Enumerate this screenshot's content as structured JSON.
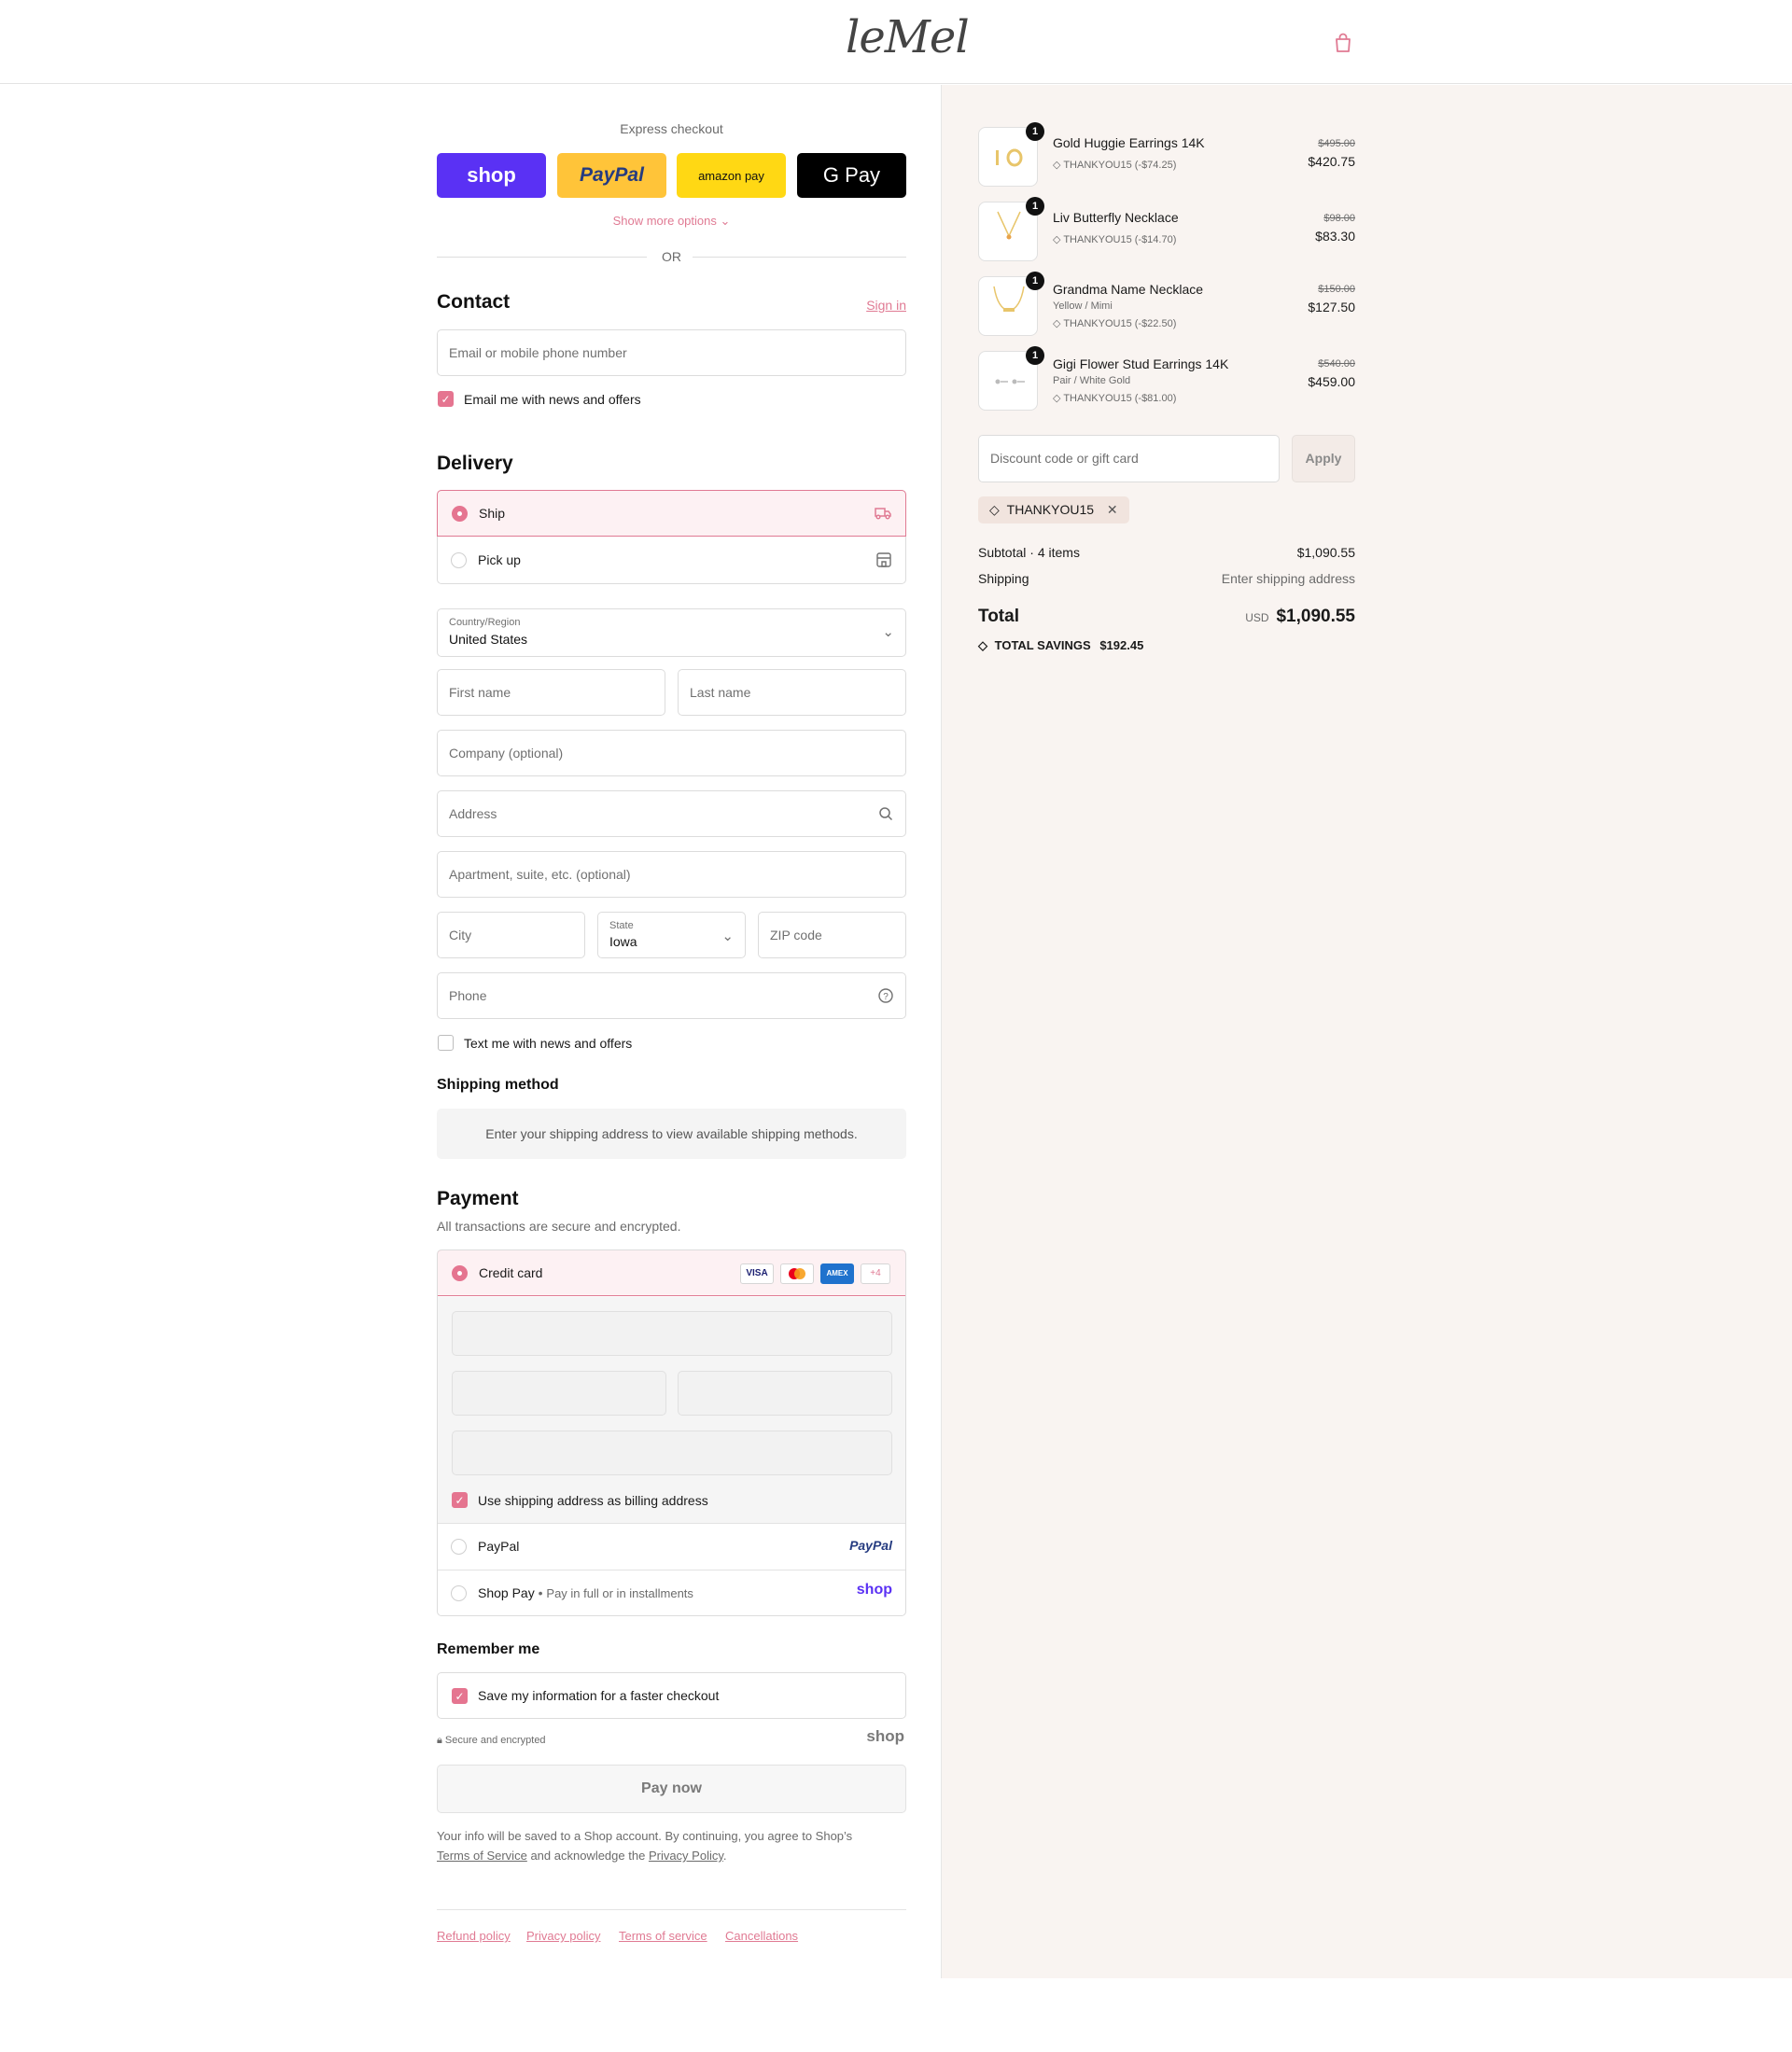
{
  "header": {
    "logo": "leMel",
    "cart_icon": "shopping-bag-icon"
  },
  "express": {
    "title": "Express checkout",
    "buttons": {
      "shop": "shop",
      "paypal": "PayPal",
      "amazon": "amazon pay",
      "gpay": "G Pay"
    },
    "more_options": "Show more options",
    "or": "OR"
  },
  "contact": {
    "title": "Contact",
    "sign_in": "Sign in",
    "email_placeholder": "Email or mobile phone number",
    "email_news_label": "Email me with news and offers",
    "email_news_checked": true
  },
  "delivery": {
    "title": "Delivery",
    "options": [
      {
        "label": "Ship",
        "selected": true,
        "icon": "truck-icon"
      },
      {
        "label": "Pick up",
        "selected": false,
        "icon": "store-icon"
      }
    ],
    "country_label": "Country/Region",
    "country_value": "United States",
    "first_name": "First name",
    "last_name": "Last name",
    "company": "Company (optional)",
    "address": "Address",
    "apartment": "Apartment, suite, etc. (optional)",
    "city": "City",
    "state_label": "State",
    "state_value": "Iowa",
    "zip": "ZIP code",
    "phone": "Phone",
    "text_news_label": "Text me with news and offers",
    "text_news_checked": false
  },
  "shipping_method": {
    "title": "Shipping method",
    "info": "Enter your shipping address to view available shipping methods."
  },
  "payment": {
    "title": "Payment",
    "subtitle": "All transactions are secure and encrypted.",
    "credit_card_label": "Credit card",
    "card_logos": [
      "VISA",
      "",
      "AMEX",
      "+4"
    ],
    "billing_label": "Use shipping address as billing address",
    "billing_checked": true,
    "paypal_label": "PayPal",
    "paypal_logo": "PayPal",
    "shoppay_label": "Shop Pay",
    "shoppay_sep": "•",
    "shoppay_sub": "Pay in full or in installments",
    "shoppay_logo": "shop"
  },
  "remember": {
    "title": "Remember me",
    "save_label": "Save my information for a faster checkout",
    "save_checked": true,
    "secure_text": "Secure and encrypted",
    "shop_logo": "shop"
  },
  "pay_now": "Pay now",
  "legal": {
    "line1": "Your info will be saved to a Shop account. By continuing, you agree to Shop’s",
    "tos": "Terms of Service",
    "and": "and acknowledge the",
    "privacy": "Privacy Policy",
    "end": "."
  },
  "footer_links": [
    "Refund policy",
    "Privacy policy",
    "Terms of service",
    "Cancellations"
  ],
  "cart": {
    "items": [
      {
        "qty": "1",
        "name": "Gold Huggie Earrings 14K",
        "variant": "",
        "discount": "THANKYOU15 (-$74.25)",
        "old_price": "$495.00",
        "price": "$420.75"
      },
      {
        "qty": "1",
        "name": "Liv Butterfly Necklace",
        "variant": "",
        "discount": "THANKYOU15 (-$14.70)",
        "old_price": "$98.00",
        "price": "$83.30"
      },
      {
        "qty": "1",
        "name": "Grandma Name Necklace",
        "variant": "Yellow / Mimi",
        "discount": "THANKYOU15 (-$22.50)",
        "old_price": "$150.00",
        "price": "$127.50"
      },
      {
        "qty": "1",
        "name": "Gigi Flower Stud Earrings 14K",
        "variant": "Pair / White Gold",
        "discount": "THANKYOU15 (-$81.00)",
        "old_price": "$540.00",
        "price": "$459.00"
      }
    ],
    "discount_placeholder": "Discount code or gift card",
    "apply": "Apply",
    "applied_code": "THANKYOU15",
    "subtotal_label": "Subtotal · 4 items",
    "subtotal_value": "$1,090.55",
    "shipping_label": "Shipping",
    "shipping_value": "Enter shipping address",
    "total_label": "Total",
    "currency": "USD",
    "total_value": "$1,090.55",
    "savings_label": "TOTAL SAVINGS",
    "savings_value": "$192.45"
  },
  "colors": {
    "accent": "#e07a93",
    "shop": "#5a31f4",
    "paypal": "#ffc439",
    "amazon": "#ffd814",
    "panel": "#f9f4f1"
  }
}
